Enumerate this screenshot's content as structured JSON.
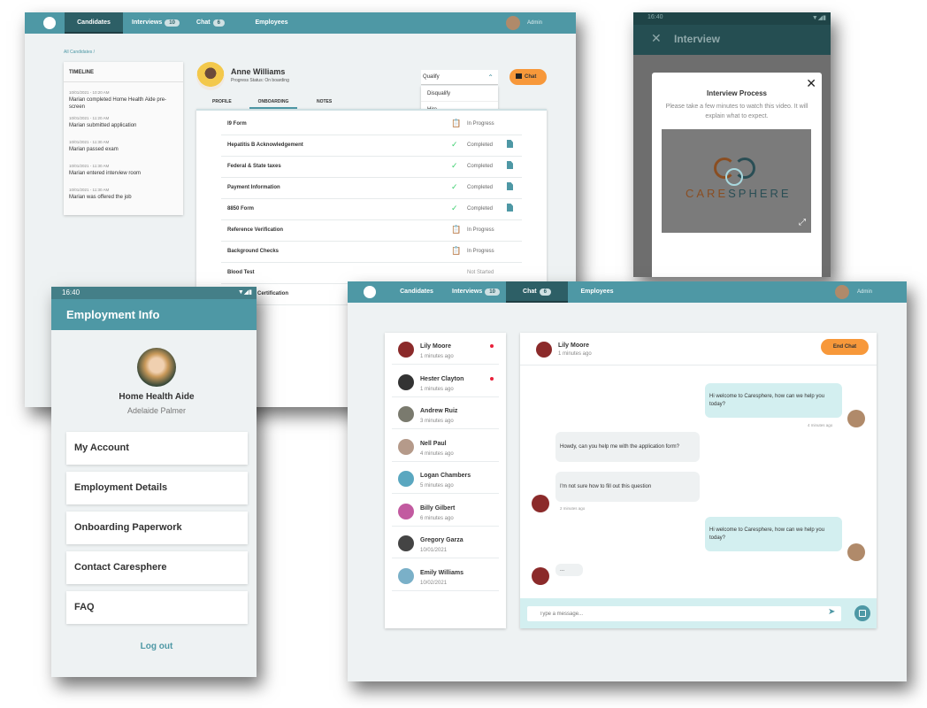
{
  "candidates_screen": {
    "nav": {
      "tabs": [
        {
          "label": "Candidates",
          "active": true
        },
        {
          "label": "Interviews",
          "badge": "10"
        },
        {
          "label": "Chat",
          "badge": "6"
        },
        {
          "label": "Employees"
        }
      ],
      "user": "Admin"
    },
    "breadcrumb": "All Candidates /",
    "timeline": {
      "title": "TIMELINE",
      "events": [
        {
          "time": "10/01/2021 - 10:20 AM",
          "text": "Marian completed Home Health Aide pre-screen"
        },
        {
          "time": "10/01/2021 - 11:20 AM",
          "text": "Marian submitted application"
        },
        {
          "time": "10/01/2021 - 11:30 AM",
          "text": "Marian passed exam"
        },
        {
          "time": "10/01/2021 - 11:30 AM",
          "text": "Marian entered interview room"
        },
        {
          "time": "10/01/2021 - 11:30 AM",
          "text": "Marian was offered the job"
        }
      ]
    },
    "candidate": {
      "name": "Anne Williams",
      "status": "Progress Status: On boarding"
    },
    "qualify_select": {
      "value": "Qualify",
      "options": [
        "Disqualify",
        "Hire"
      ]
    },
    "chat_button": "Chat",
    "tabs": [
      "PROFILE",
      "ONBOARDING",
      "NOTES"
    ],
    "active_tab": "ONBOARDING",
    "onboarding": [
      {
        "label": "I9 Form",
        "status": "In Progress",
        "icon": "clipboard-icon"
      },
      {
        "label": "Hepatitis B Acknowledgement",
        "status": "Completed",
        "icon": "check-icon",
        "doc": true
      },
      {
        "label": "Federal & State taxes",
        "status": "Completed",
        "icon": "check-icon",
        "doc": true
      },
      {
        "label": "Payment Information",
        "status": "Completed",
        "icon": "check-icon",
        "doc": true
      },
      {
        "label": "8850 Form",
        "status": "Completed",
        "icon": "check-icon",
        "doc": true
      },
      {
        "label": "Reference Verification",
        "status": "In Progress",
        "icon": "clipboard-icon"
      },
      {
        "label": "Background Checks",
        "status": "In Progress",
        "icon": "clipboard-icon"
      },
      {
        "label": "Blood Test",
        "status": "Not Started"
      },
      {
        "label": "Certification"
      }
    ]
  },
  "interview_screen": {
    "status_time": "16:40",
    "header": "Interview",
    "modal_title": "Interview Process",
    "modal_text": "Please take a few minutes to watch this video. It will explain what to expect.",
    "logo_text_a": "CARE",
    "logo_text_b": "SPHERE"
  },
  "employment_screen": {
    "status_time": "16:40",
    "header": "Employment Info",
    "job_title": "Home Health Aide",
    "name": "Adelaide Palmer",
    "menu": [
      "My Account",
      "Employment Details",
      "Onboarding Paperwork",
      "Contact Caresphere",
      "FAQ"
    ],
    "logout": "Log out"
  },
  "chat_screen": {
    "nav": {
      "tabs": [
        {
          "label": "Candidates"
        },
        {
          "label": "Interviews",
          "badge": "10"
        },
        {
          "label": "Chat",
          "badge": "6",
          "active": true
        },
        {
          "label": "Employees"
        }
      ],
      "user": "Admin"
    },
    "contacts": [
      {
        "name": "Lily Moore",
        "time": "1 minutes ago",
        "unread": true,
        "color": "#8b2a2a"
      },
      {
        "name": "Hester Clayton",
        "time": "1 minutes ago",
        "unread": true,
        "color": "#333"
      },
      {
        "name": "Andrew Ruiz",
        "time": "3 minutes ago",
        "color": "#7a7a6e"
      },
      {
        "name": "Nell Paul",
        "time": "4 minutes ago",
        "color": "#b59a8a"
      },
      {
        "name": "Logan Chambers",
        "time": "5 minutes ago",
        "color": "#5aa7c0"
      },
      {
        "name": "Billy Gilbert",
        "time": "6 minutes ago",
        "color": "#c25aa0"
      },
      {
        "name": "Gregory Garza",
        "time": "10/01/2021",
        "color": "#444"
      },
      {
        "name": "Emily Williams",
        "time": "10/02/2021",
        "color": "#7ab0c8"
      }
    ],
    "active": {
      "name": "Lily Moore",
      "time": "1 minutes ago"
    },
    "end_chat": "End Chat",
    "messages": [
      {
        "side": "right",
        "text": "Hi welcome to Caresphere, how can we help you today?",
        "time": "4 minutes ago"
      },
      {
        "side": "left",
        "text": "Howdy, can you help me with the application form?"
      },
      {
        "side": "left",
        "text": "I'm not sure how to fill out this question",
        "time": "2 minutes ago"
      },
      {
        "side": "right",
        "text": "Hi welcome to Caresphere, how can we help you today?"
      },
      {
        "side": "left",
        "text": "..."
      }
    ],
    "input_placeholder": "Type a message..."
  },
  "colors": {
    "teal": "#4e98a5",
    "dark_teal": "#2d5f66",
    "orange": "#f7983a",
    "bubble": "#d3eff0",
    "bg": "#eef2f3"
  }
}
